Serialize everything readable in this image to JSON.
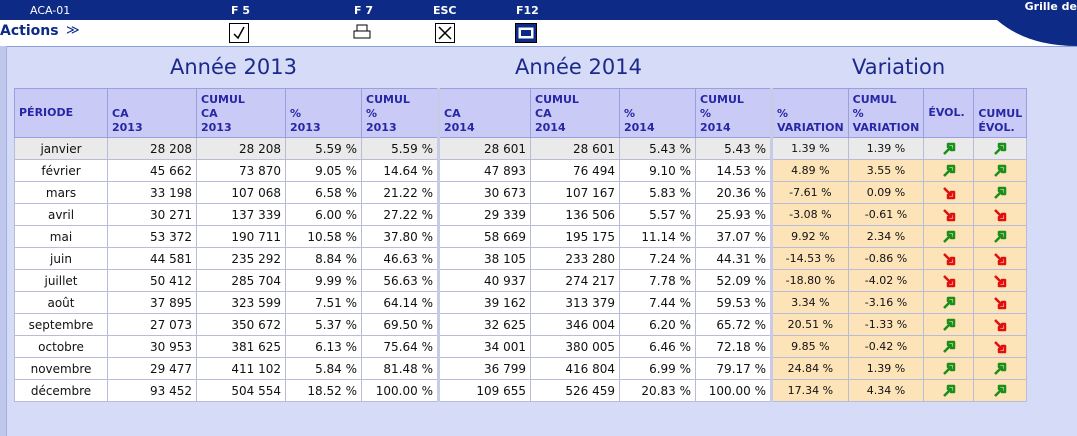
{
  "topbar": {
    "code": "ACA-01",
    "f5": "F 5",
    "f7": "F 7",
    "esc": "ESC",
    "f12": "F12",
    "grille": "Grille de"
  },
  "actionbar": {
    "actions_label": "Actions",
    "chevron": "≫"
  },
  "headers": {
    "year1": "Année 2013",
    "year2": "Année 2014",
    "variation": "Variation"
  },
  "columns": {
    "periode": "PÉRIODE",
    "ca2013": [
      "CA",
      "2013"
    ],
    "cumca2013": [
      "CUMUL",
      "CA",
      "2013"
    ],
    "pct2013": [
      "%",
      "2013"
    ],
    "cumpct2013": [
      "CUMUL",
      "%",
      "2013"
    ],
    "ca2014": [
      "CA",
      "2014"
    ],
    "cumca2014": [
      "CUMUL",
      "CA",
      "2014"
    ],
    "pct2014": [
      "%",
      "2014"
    ],
    "cumpct2014": [
      "CUMUL",
      "%",
      "2014"
    ],
    "pctvar": [
      "%",
      "VARIATION"
    ],
    "cumvar": [
      "CUMUL",
      "%",
      "VARIATION"
    ],
    "evol": [
      "ÉVOL."
    ],
    "cumevol": [
      "CUMUL",
      "ÉVOL."
    ]
  },
  "colors": {
    "up": "#1a8f1a",
    "down": "#e01010"
  },
  "rows": [
    [
      "janvier",
      "28 208",
      "28 208",
      "5.59 %",
      "5.59 %",
      "28 601",
      "28 601",
      "5.43 %",
      "5.43 %",
      "1.39 %",
      "1.39 %",
      "up",
      "up"
    ],
    [
      "février",
      "45 662",
      "73 870",
      "9.05 %",
      "14.64 %",
      "47 893",
      "76 494",
      "9.10 %",
      "14.53 %",
      "4.89 %",
      "3.55 %",
      "up",
      "up"
    ],
    [
      "mars",
      "33 198",
      "107 068",
      "6.58 %",
      "21.22 %",
      "30 673",
      "107 167",
      "5.83 %",
      "20.36 %",
      "-7.61 %",
      "0.09 %",
      "down",
      "up"
    ],
    [
      "avril",
      "30 271",
      "137 339",
      "6.00 %",
      "27.22 %",
      "29 339",
      "136 506",
      "5.57 %",
      "25.93 %",
      "-3.08 %",
      "-0.61 %",
      "down",
      "down"
    ],
    [
      "mai",
      "53 372",
      "190 711",
      "10.58 %",
      "37.80 %",
      "58 669",
      "195 175",
      "11.14 %",
      "37.07 %",
      "9.92 %",
      "2.34 %",
      "up",
      "up"
    ],
    [
      "juin",
      "44 581",
      "235 292",
      "8.84 %",
      "46.63 %",
      "38 105",
      "233 280",
      "7.24 %",
      "44.31 %",
      "-14.53 %",
      "-0.86 %",
      "down",
      "down"
    ],
    [
      "juillet",
      "50 412",
      "285 704",
      "9.99 %",
      "56.63 %",
      "40 937",
      "274 217",
      "7.78 %",
      "52.09 %",
      "-18.80 %",
      "-4.02 %",
      "down",
      "down"
    ],
    [
      "août",
      "37 895",
      "323 599",
      "7.51 %",
      "64.14 %",
      "39 162",
      "313 379",
      "7.44 %",
      "59.53 %",
      "3.34 %",
      "-3.16 %",
      "up",
      "down"
    ],
    [
      "septembre",
      "27 073",
      "350 672",
      "5.37 %",
      "69.50 %",
      "32 625",
      "346 004",
      "6.20 %",
      "65.72 %",
      "20.51 %",
      "-1.33 %",
      "up",
      "down"
    ],
    [
      "octobre",
      "30 953",
      "381 625",
      "6.13 %",
      "75.64 %",
      "34 001",
      "380 005",
      "6.46 %",
      "72.18 %",
      "9.85 %",
      "-0.42 %",
      "up",
      "down"
    ],
    [
      "novembre",
      "29 477",
      "411 102",
      "5.84 %",
      "81.48 %",
      "36 799",
      "416 804",
      "6.99 %",
      "79.17 %",
      "24.84 %",
      "1.39 %",
      "up",
      "up"
    ],
    [
      "décembre",
      "93 452",
      "504 554",
      "18.52 %",
      "100.00 %",
      "109 655",
      "526 459",
      "20.83 %",
      "100.00 %",
      "17.34 %",
      "4.34 %",
      "up",
      "up"
    ]
  ]
}
